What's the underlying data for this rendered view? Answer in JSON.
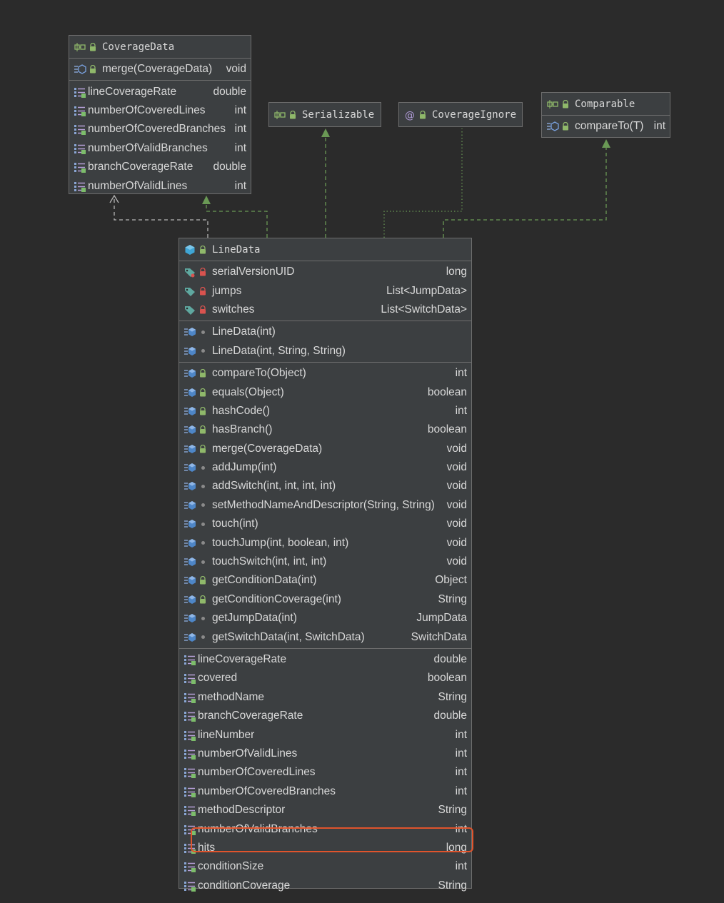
{
  "coverage_data": {
    "title": "CoverageData",
    "methods": [
      {
        "name": "merge(CoverageData)",
        "type": "void"
      }
    ],
    "properties": [
      {
        "name": "lineCoverageRate",
        "type": "double"
      },
      {
        "name": "numberOfCoveredLines",
        "type": "int"
      },
      {
        "name": "numberOfCoveredBranches",
        "type": "int"
      },
      {
        "name": "numberOfValidBranches",
        "type": "int"
      },
      {
        "name": "branchCoverageRate",
        "type": "double"
      },
      {
        "name": "numberOfValidLines",
        "type": "int"
      }
    ]
  },
  "serializable": {
    "title": "Serializable"
  },
  "coverage_ignore": {
    "title": "CoverageIgnore"
  },
  "comparable": {
    "title": "Comparable",
    "methods": [
      {
        "name": "compareTo(T)",
        "type": "int"
      }
    ]
  },
  "line_data": {
    "title": "LineData",
    "fields": [
      {
        "name": "serialVersionUID",
        "type": "long",
        "static": true
      },
      {
        "name": "jumps",
        "type": "List<JumpData>",
        "static": false
      },
      {
        "name": "switches",
        "type": "List<SwitchData>",
        "static": false
      }
    ],
    "constructors": [
      {
        "name": "LineData(int)",
        "type": ""
      },
      {
        "name": "LineData(int, String, String)",
        "type": ""
      }
    ],
    "methods": [
      {
        "name": "compareTo(Object)",
        "type": "int",
        "public": true
      },
      {
        "name": "equals(Object)",
        "type": "boolean",
        "public": true
      },
      {
        "name": "hashCode()",
        "type": "int",
        "public": true
      },
      {
        "name": "hasBranch()",
        "type": "boolean",
        "public": true
      },
      {
        "name": "merge(CoverageData)",
        "type": "void",
        "public": true
      },
      {
        "name": "addJump(int)",
        "type": "void",
        "public": false
      },
      {
        "name": "addSwitch(int, int, int, int)",
        "type": "void",
        "public": false
      },
      {
        "name": "setMethodNameAndDescriptor(String, String)",
        "type": "void",
        "public": false
      },
      {
        "name": "touch(int)",
        "type": "void",
        "public": false
      },
      {
        "name": "touchJump(int, boolean, int)",
        "type": "void",
        "public": false
      },
      {
        "name": "touchSwitch(int, int, int)",
        "type": "void",
        "public": false
      },
      {
        "name": "getConditionData(int)",
        "type": "Object",
        "public": true
      },
      {
        "name": "getConditionCoverage(int)",
        "type": "String",
        "public": true
      },
      {
        "name": "getJumpData(int)",
        "type": "JumpData",
        "public": false
      },
      {
        "name": "getSwitchData(int, SwitchData)",
        "type": "SwitchData",
        "public": false
      }
    ],
    "properties": [
      {
        "name": "lineCoverageRate",
        "type": "double"
      },
      {
        "name": "covered",
        "type": "boolean"
      },
      {
        "name": "methodName",
        "type": "String"
      },
      {
        "name": "branchCoverageRate",
        "type": "double"
      },
      {
        "name": "lineNumber",
        "type": "int"
      },
      {
        "name": "numberOfValidLines",
        "type": "int"
      },
      {
        "name": "numberOfCoveredLines",
        "type": "int"
      },
      {
        "name": "numberOfCoveredBranches",
        "type": "int"
      },
      {
        "name": "methodDescriptor",
        "type": "String"
      },
      {
        "name": "numberOfValidBranches",
        "type": "int"
      },
      {
        "name": "hits",
        "type": "long"
      },
      {
        "name": "conditionSize",
        "type": "int"
      },
      {
        "name": "conditionCoverage",
        "type": "String"
      }
    ],
    "highlighted_property": "hits"
  },
  "colors": {
    "background": "#2b2b2b",
    "panel": "#3c3f41",
    "border": "#6d6d6d",
    "realization_arrow": "#6a9955",
    "highlight": "#e0542c"
  }
}
